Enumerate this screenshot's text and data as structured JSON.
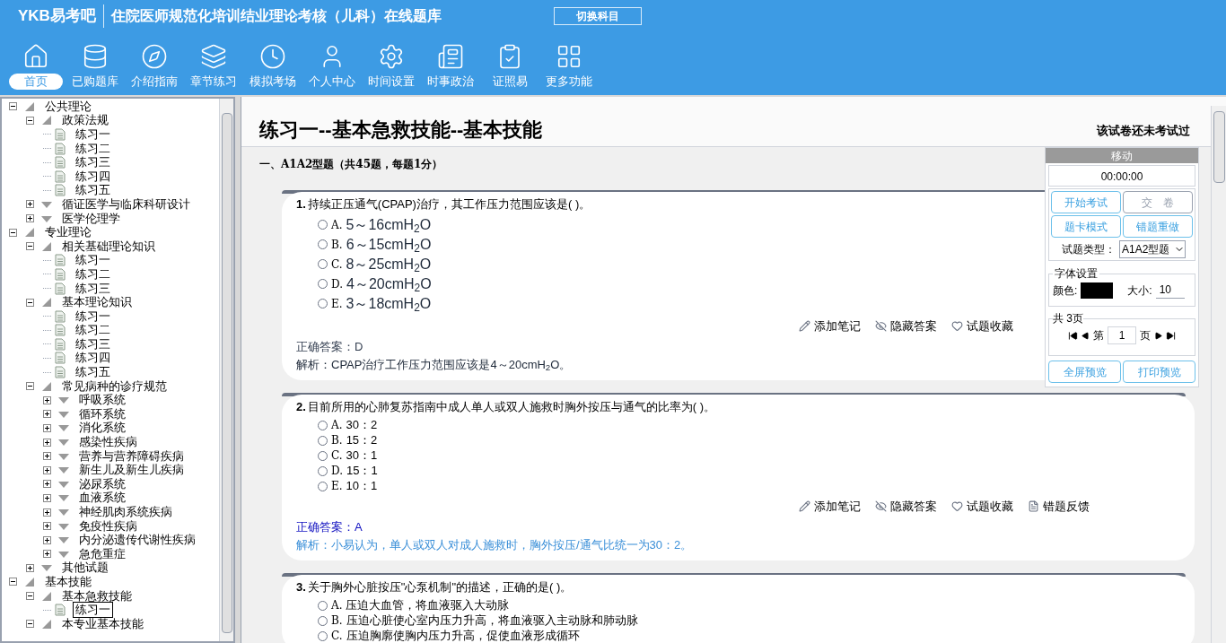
{
  "header": {
    "logo": "YKB易考吧",
    "title": "住院医师规范化培训结业理论考核（儿科）在线题库",
    "switch_button": "切换科目"
  },
  "nav": [
    {
      "label": "首页",
      "selected": true
    },
    {
      "label": "已购题库",
      "selected": false
    },
    {
      "label": "介绍指南",
      "selected": false
    },
    {
      "label": "章节练习",
      "selected": false
    },
    {
      "label": "模拟考场",
      "selected": false
    },
    {
      "label": "个人中心",
      "selected": false
    },
    {
      "label": "时间设置",
      "selected": false
    },
    {
      "label": "时事政治",
      "selected": false
    },
    {
      "label": "证照易",
      "selected": false
    },
    {
      "label": "更多功能",
      "selected": false
    }
  ],
  "tree": [
    {
      "kind": "folder",
      "label": "公共理论",
      "expanded": true,
      "selected": false,
      "children": [
        {
          "kind": "folder",
          "label": "政策法规",
          "expanded": true,
          "selected": false,
          "children": [
            {
              "kind": "exercise",
              "label": "练习一",
              "selected": false
            },
            {
              "kind": "exercise",
              "label": "练习二",
              "selected": false
            },
            {
              "kind": "exercise",
              "label": "练习三",
              "selected": false
            },
            {
              "kind": "exercise",
              "label": "练习四",
              "selected": false
            },
            {
              "kind": "exercise",
              "label": "练习五",
              "selected": false
            }
          ]
        },
        {
          "kind": "folder",
          "label": "循证医学与临床科研设计",
          "expanded": false,
          "selected": false
        },
        {
          "kind": "folder",
          "label": "医学伦理学",
          "expanded": false,
          "selected": false
        }
      ]
    },
    {
      "kind": "folder",
      "label": "专业理论",
      "expanded": true,
      "selected": false,
      "children": [
        {
          "kind": "folder",
          "label": "相关基础理论知识",
          "expanded": true,
          "selected": false,
          "children": [
            {
              "kind": "exercise",
              "label": "练习一",
              "selected": false
            },
            {
              "kind": "exercise",
              "label": "练习二",
              "selected": false
            },
            {
              "kind": "exercise",
              "label": "练习三",
              "selected": false
            }
          ]
        },
        {
          "kind": "folder",
          "label": "基本理论知识",
          "expanded": true,
          "selected": false,
          "children": [
            {
              "kind": "exercise",
              "label": "练习一",
              "selected": false
            },
            {
              "kind": "exercise",
              "label": "练习二",
              "selected": false
            },
            {
              "kind": "exercise",
              "label": "练习三",
              "selected": false
            },
            {
              "kind": "exercise",
              "label": "练习四",
              "selected": false
            },
            {
              "kind": "exercise",
              "label": "练习五",
              "selected": false
            }
          ]
        },
        {
          "kind": "folder",
          "label": "常见病种的诊疗规范",
          "expanded": true,
          "selected": false,
          "children": [
            {
              "kind": "folder",
              "label": "呼吸系统",
              "expanded": false,
              "selected": false
            },
            {
              "kind": "folder",
              "label": "循环系统",
              "expanded": false,
              "selected": false
            },
            {
              "kind": "folder",
              "label": "消化系统",
              "expanded": false,
              "selected": false
            },
            {
              "kind": "folder",
              "label": "感染性疾病",
              "expanded": false,
              "selected": false
            },
            {
              "kind": "folder",
              "label": "营养与营养障碍疾病",
              "expanded": false,
              "selected": false
            },
            {
              "kind": "folder",
              "label": "新生儿及新生儿疾病",
              "expanded": false,
              "selected": false
            },
            {
              "kind": "folder",
              "label": "泌尿系统",
              "expanded": false,
              "selected": false
            },
            {
              "kind": "folder",
              "label": "血液系统",
              "expanded": false,
              "selected": false
            },
            {
              "kind": "folder",
              "label": "神经肌肉系统疾病",
              "expanded": false,
              "selected": false
            },
            {
              "kind": "folder",
              "label": "免疫性疾病",
              "expanded": false,
              "selected": false
            },
            {
              "kind": "folder",
              "label": "内分泌遗传代谢性疾病",
              "expanded": false,
              "selected": false
            },
            {
              "kind": "folder",
              "label": "急危重症",
              "expanded": false,
              "selected": false
            }
          ]
        },
        {
          "kind": "folder",
          "label": "其他试题",
          "expanded": false,
          "selected": false
        }
      ]
    },
    {
      "kind": "folder",
      "label": "基本技能",
      "expanded": true,
      "selected": false,
      "children": [
        {
          "kind": "folder",
          "label": "基本急救技能",
          "expanded": true,
          "selected": false,
          "children": [
            {
              "kind": "exercise",
              "label": "练习一",
              "selected": true
            }
          ]
        },
        {
          "kind": "folder",
          "label": "本专业基本技能",
          "expanded": true,
          "selected": false
        }
      ]
    }
  ],
  "paper": {
    "title": "练习一--基本急救技能--基本技能",
    "status": "该试卷还未考试过",
    "section": "一、A1A2型题（共45题，每题1分）"
  },
  "questions": [
    {
      "number": "1.",
      "text": "持续正压通气(CPAP)治疗，其工作压力范围应该是( )。",
      "options": [
        {
          "letter": "A.",
          "text": "5～16cmH$_{2}$O",
          "selected": false
        },
        {
          "letter": "B.",
          "text": "6～15cmH$_{2}$O",
          "selected": false
        },
        {
          "letter": "C.",
          "text": "8～25cmH$_{2}$O",
          "selected": false
        },
        {
          "letter": "D.",
          "text": "4～20cmH$_{2}$O",
          "selected": false
        },
        {
          "letter": "E.",
          "text": "3～18cmH$_{2}$O",
          "selected": false
        }
      ],
      "actions": [
        "添加笔记",
        "隐藏答案",
        "试题收藏"
      ],
      "answer": "正确答案：D",
      "analysis": "解析：CPAP治疗工作压力范围应该是4～20cmH$_{2}$O。",
      "highlight": false
    },
    {
      "number": "2.",
      "text": "目前所用的心肺复苏指南中成人单人或双人施救时胸外按压与通气的比率为( )。",
      "options": [
        {
          "letter": "A.",
          "text": "30：2",
          "selected": false
        },
        {
          "letter": "B.",
          "text": "15：2",
          "selected": false
        },
        {
          "letter": "C.",
          "text": "30：1",
          "selected": false
        },
        {
          "letter": "D.",
          "text": "15：1",
          "selected": false
        },
        {
          "letter": "E.",
          "text": "10：1",
          "selected": false
        }
      ],
      "actions": [
        "添加笔记",
        "隐藏答案",
        "试题收藏",
        "错题反馈"
      ],
      "answer": "正确答案：A",
      "analysis": "解析：小易认为，单人或双人对成人施救时，胸外按压/通气比统一为30：2。",
      "highlight": true
    },
    {
      "number": "3.",
      "text": "关于胸外心脏按压\"心泵机制\"的描述，正确的是( )。",
      "options": [
        {
          "letter": "A.",
          "text": "压迫大血管，将血液驱入大动脉",
          "selected": false
        },
        {
          "letter": "B.",
          "text": "压迫心脏使心室内压力升高，将血液驱入主动脉和肺动脉",
          "selected": false
        },
        {
          "letter": "C.",
          "text": "压迫胸廓使胸内压力升高，促使血液形成循环",
          "selected": false
        }
      ]
    }
  ],
  "panel": {
    "header": "移动",
    "timer": "00:00:00",
    "buttons": [
      {
        "label": "开始考试",
        "disabled": false
      },
      {
        "label": "交　卷",
        "disabled": true
      },
      {
        "label": "题卡模式",
        "disabled": false
      },
      {
        "label": "错题重做",
        "disabled": false
      }
    ],
    "type_label": "试题类型：",
    "type_value": "A1A2型题",
    "font_legend": "字体设置",
    "color_label": "颜色:",
    "swatch": {
      "color": "#000000"
    },
    "size_label": "大小:",
    "size_value": "10",
    "pages_legend": "共 3页",
    "page_prefix": "第",
    "page_value": "1",
    "page_suffix": "页",
    "bottom_buttons": [
      "全屏预览",
      "打印预览"
    ]
  }
}
